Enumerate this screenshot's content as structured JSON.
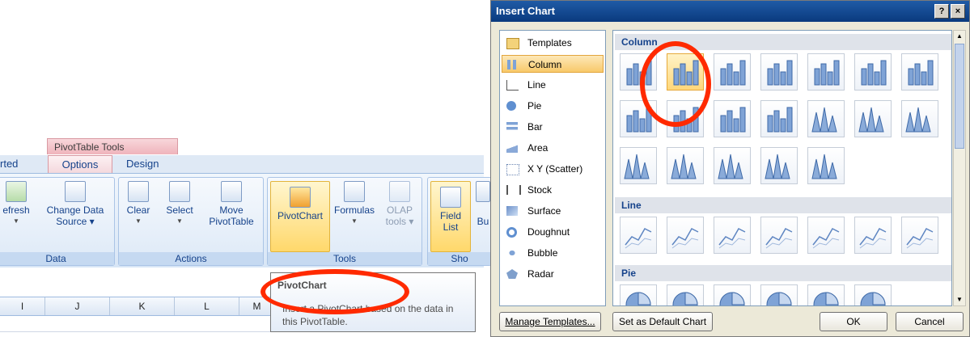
{
  "ribbon": {
    "context_title": "PivotTable Tools",
    "tabs": [
      {
        "label": "rted"
      },
      {
        "label": "Options"
      },
      {
        "label": "Design"
      }
    ],
    "groups": {
      "data": {
        "label": "Data",
        "refresh": "efresh",
        "change_source_1": "Change Data",
        "change_source_2": "Source ▾"
      },
      "actions": {
        "label": "Actions",
        "clear": "Clear",
        "select": "Select",
        "move_1": "Move",
        "move_2": "PivotTable"
      },
      "tools": {
        "label": "Tools",
        "pivotchart": "PivotChart",
        "formulas": "Formulas",
        "olap_1": "OLAP",
        "olap_2": "tools ▾"
      },
      "show": {
        "label": "Sho",
        "field_list_1": "Field",
        "field_list_2": "List",
        "buttons": "Bu"
      }
    },
    "columns": [
      "I",
      "J",
      "K",
      "L",
      "M"
    ],
    "tooltip": {
      "title": "PivotChart",
      "text": "Insert a PivotChart based on the data in this PivotTable."
    }
  },
  "dialog": {
    "title": "Insert Chart",
    "help": "?",
    "close": "×",
    "categories": [
      {
        "label": "Templates",
        "icon": "folder-icon"
      },
      {
        "label": "Column",
        "icon": "column-chart-icon",
        "selected": true
      },
      {
        "label": "Line",
        "icon": "line-chart-icon"
      },
      {
        "label": "Pie",
        "icon": "pie-chart-icon"
      },
      {
        "label": "Bar",
        "icon": "bar-chart-icon"
      },
      {
        "label": "Area",
        "icon": "area-chart-icon"
      },
      {
        "label": "X Y (Scatter)",
        "icon": "scatter-chart-icon"
      },
      {
        "label": "Stock",
        "icon": "stock-chart-icon"
      },
      {
        "label": "Surface",
        "icon": "surface-chart-icon"
      },
      {
        "label": "Doughnut",
        "icon": "doughnut-chart-icon"
      },
      {
        "label": "Bubble",
        "icon": "bubble-chart-icon"
      },
      {
        "label": "Radar",
        "icon": "radar-chart-icon"
      }
    ],
    "sections": {
      "column": "Column",
      "line": "Line",
      "pie": "Pie"
    },
    "buttons": {
      "manage": "Manage Templates...",
      "default": "Set as Default Chart",
      "ok": "OK",
      "cancel": "Cancel"
    },
    "accent": "#0a3a7e",
    "highlight": "#ff2a00"
  }
}
